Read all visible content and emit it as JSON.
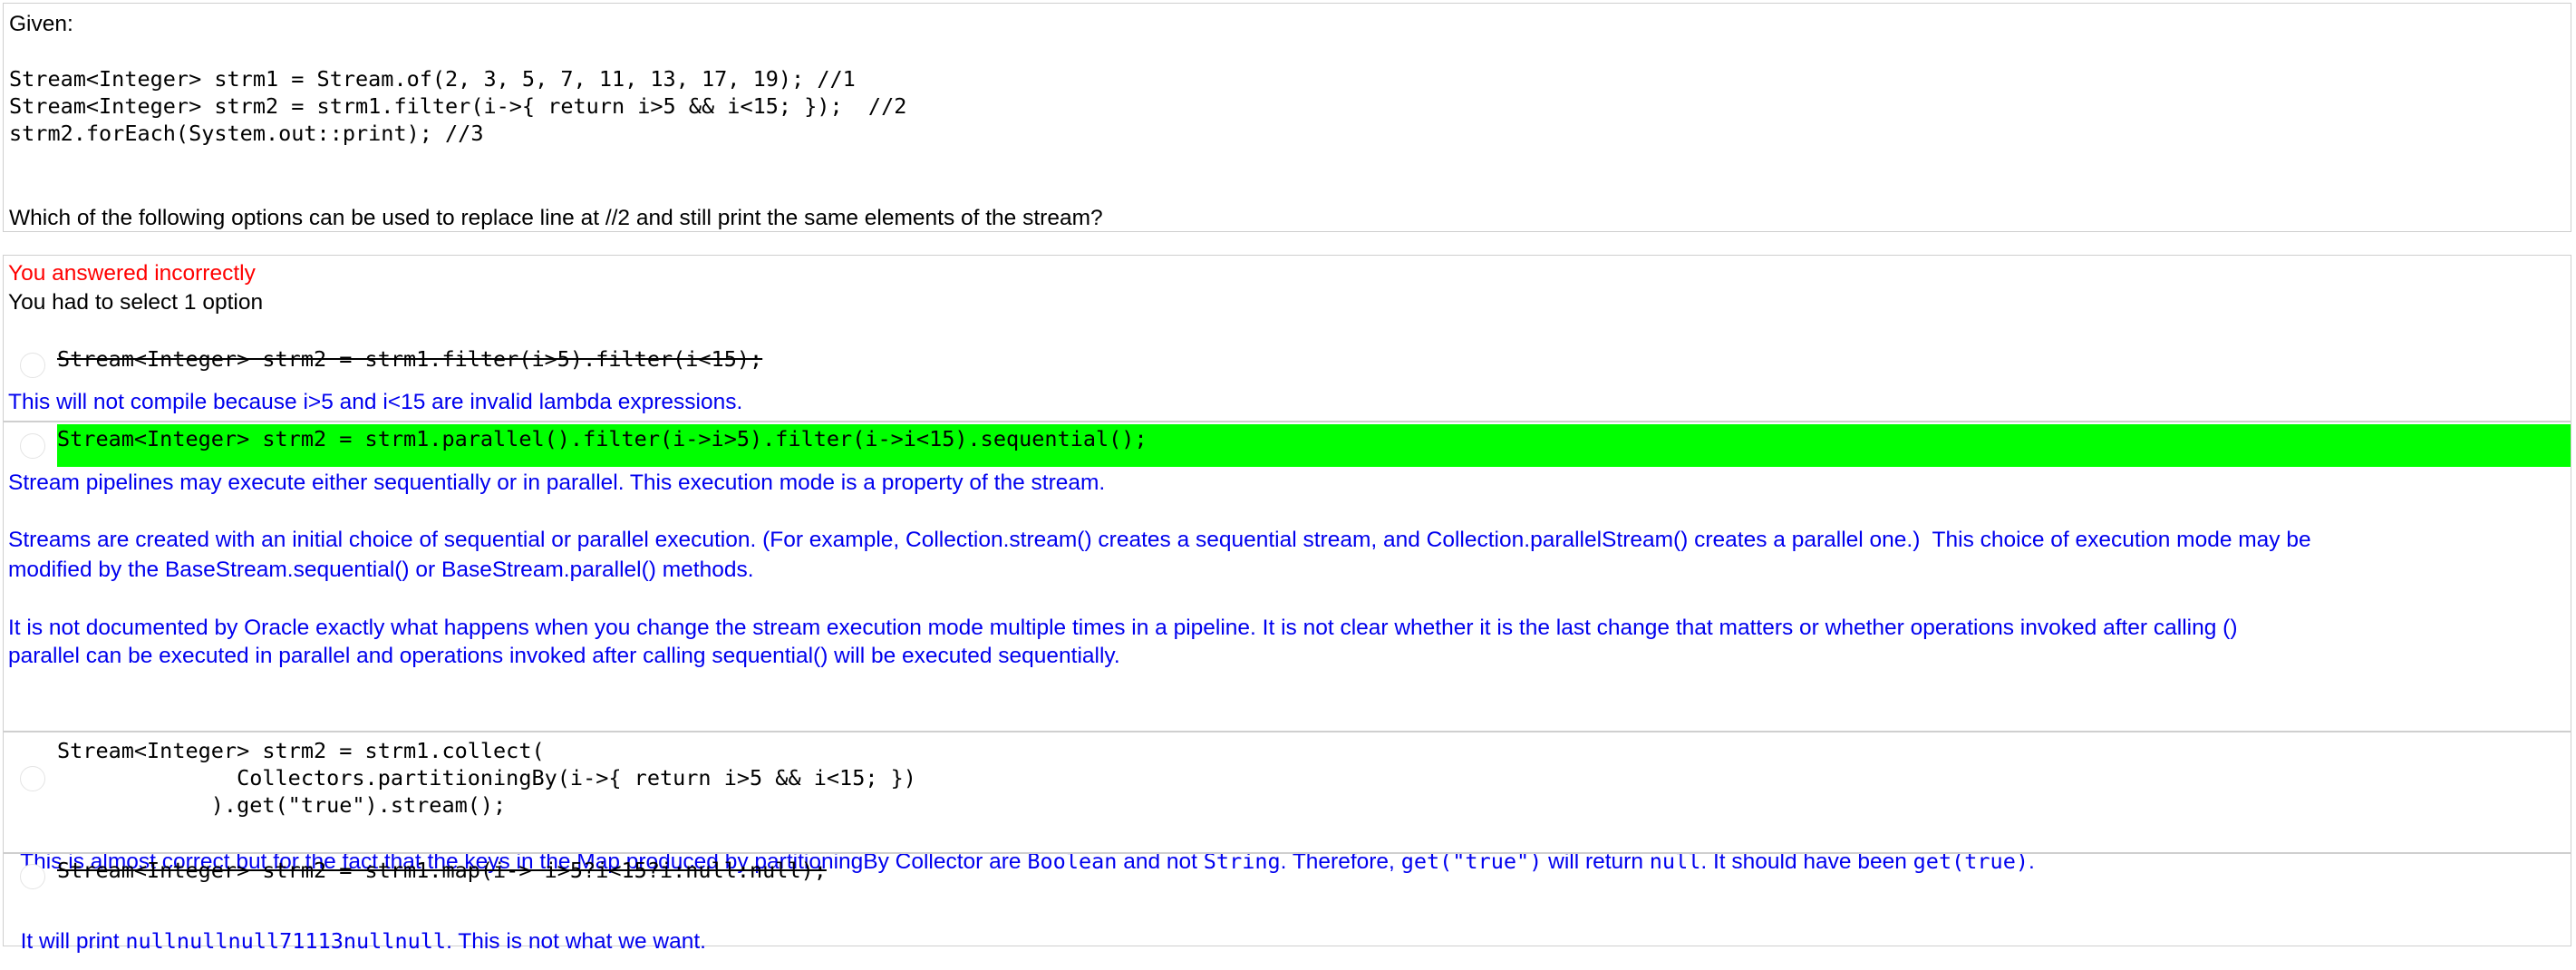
{
  "question": {
    "given_label": "Given:",
    "code_lines": [
      "Stream<Integer> strm1 = Stream.of(2, 3, 5, 7, 11, 13, 17, 19); //1",
      "Stream<Integer> strm2 = strm1.filter(i->{ return i>5 && i<15; });  //2",
      "strm2.forEach(System.out::print); //3"
    ],
    "prompt": "Which of the following options can be used to replace line at //2 and still print the same elements of the stream?"
  },
  "result": {
    "status": "You answered incorrectly",
    "instruction": "You had to select 1 option",
    "status_color": "#ff0000"
  },
  "options": [
    {
      "code_lines": [
        "Stream<Integer> strm2 = strm1.filter(i>5).filter(i<15);"
      ],
      "struck": true,
      "correct": false,
      "explanation": [
        "This will not compile because i>5 and i<15 are invalid lambda expressions."
      ]
    },
    {
      "code_lines": [
        "Stream<Integer> strm2 = strm1.parallel().filter(i->i>5).filter(i->i<15).sequential();"
      ],
      "struck": false,
      "correct": true,
      "highlight_color": "#00ff00",
      "explanation": [
        "Stream pipelines may execute either sequentially or in parallel. This execution mode is a property of the stream.",
        "Streams are created with an initial choice of sequential or parallel execution. (For example, Collection.stream() creates a sequential stream, and Collection.parallelStream() creates a parallel one.)  This choice of execution mode may be",
        "modified by the BaseStream.sequential() or BaseStream.parallel() methods.",
        "It is not documented by Oracle exactly what happens when you change the stream execution mode multiple times in a pipeline. It is not clear whether it is the last change that matters or whether operations invoked after calling ()",
        "parallel can be executed in parallel and operations invoked after calling sequential() will be executed sequentially."
      ]
    },
    {
      "code_lines": [
        "Stream<Integer> strm2 = strm1.collect(",
        "              Collectors.partitioningBy(i->{ return i>5 && i<15; })",
        "            ).get(\"true\").stream();"
      ],
      "struck": false,
      "correct": false,
      "explanation_parts": [
        {
          "text": "This is almost correct but for the fact that the keys in the Map produced by partitioningBy Collector are ",
          "mono": false
        },
        {
          "text": "Boolean",
          "mono": true
        },
        {
          "text": " and not ",
          "mono": false
        },
        {
          "text": "String",
          "mono": true
        },
        {
          "text": ". Therefore, ",
          "mono": false
        },
        {
          "text": "get(\"true\")",
          "mono": true
        },
        {
          "text": " will return ",
          "mono": false
        },
        {
          "text": "null",
          "mono": true
        },
        {
          "text": ". It should have been ",
          "mono": false
        },
        {
          "text": "get(true)",
          "mono": true
        },
        {
          "text": ".",
          "mono": false
        }
      ]
    },
    {
      "code_lines": [
        "Stream<Integer> strm2 = strm1.map(i-> i>5?i<15?i:null:null);"
      ],
      "struck": true,
      "correct": false,
      "explanation_parts": [
        {
          "text": "It will print ",
          "mono": false
        },
        {
          "text": "nullnullnull71113nullnull",
          "mono": true
        },
        {
          "text": ". This is not what we want.",
          "mono": false
        }
      ]
    }
  ],
  "colors": {
    "explanation": "#0000ee",
    "border": "#cfcfcf"
  }
}
